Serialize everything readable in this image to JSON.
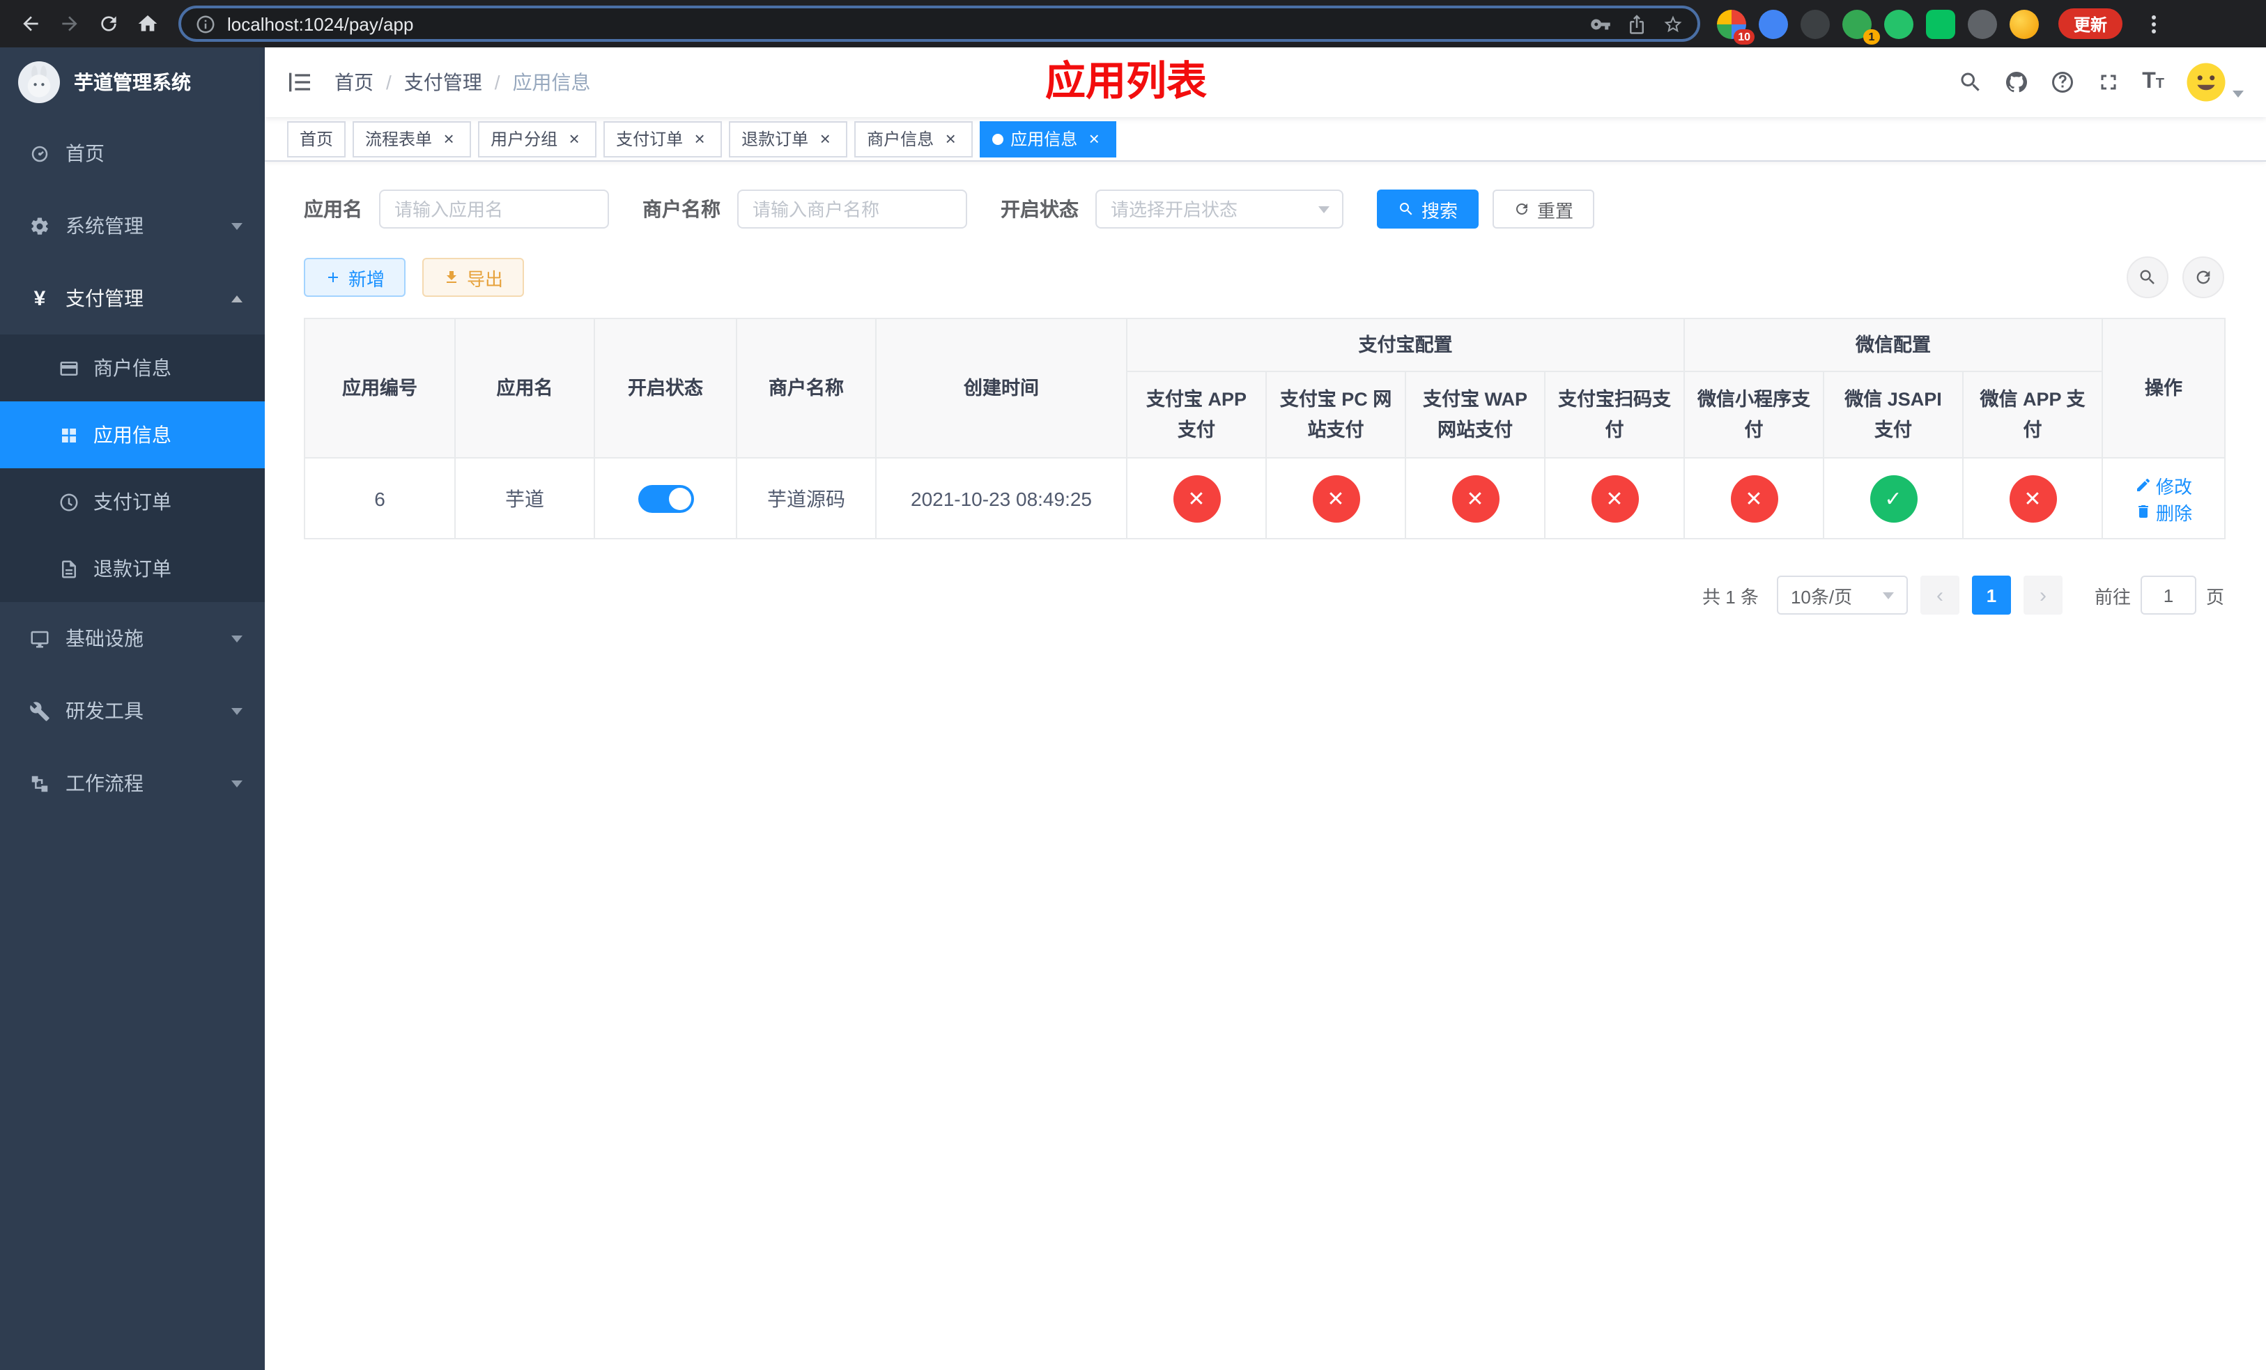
{
  "colors": {
    "primary": "#1890ff",
    "danger": "#f5413d",
    "success": "#19be6b",
    "title": "#f20d0d",
    "sidebar_bg": "#2f3d50"
  },
  "icons": {
    "close_tab": "×",
    "status_on": "✓",
    "status_off": "✕",
    "breadcrumb_separator": "/",
    "prev_arrow": "‹",
    "next_arrow": "›",
    "yen": "¥",
    "font_large": "T",
    "font_small": "T"
  },
  "browser": {
    "url": "localhost:1024/pay/app",
    "update_button": "更新",
    "extension_badge": "10",
    "profile_badge": "1"
  },
  "sidebar": {
    "app_title": "芋道管理系统",
    "menu": [
      {
        "label": "首页"
      },
      {
        "label": "系统管理"
      },
      {
        "label": "支付管理"
      },
      {
        "label": "基础设施"
      },
      {
        "label": "研发工具"
      },
      {
        "label": "工作流程"
      }
    ],
    "pay_submenu": [
      {
        "label": "商户信息"
      },
      {
        "label": "应用信息"
      },
      {
        "label": "支付订单"
      },
      {
        "label": "退款订单"
      }
    ]
  },
  "header": {
    "breadcrumb": [
      "首页",
      "支付管理",
      "应用信息"
    ],
    "page_title": "应用列表"
  },
  "tags": [
    {
      "label": "首页",
      "closable": false,
      "active": false
    },
    {
      "label": "流程表单",
      "closable": true,
      "active": false
    },
    {
      "label": "用户分组",
      "closable": true,
      "active": false
    },
    {
      "label": "支付订单",
      "closable": true,
      "active": false
    },
    {
      "label": "退款订单",
      "closable": true,
      "active": false
    },
    {
      "label": "商户信息",
      "closable": true,
      "active": false
    },
    {
      "label": "应用信息",
      "closable": true,
      "active": true
    }
  ],
  "filters": {
    "app_name_label": "应用名",
    "app_name_placeholder": "请输入应用名",
    "merchant_label": "商户名称",
    "merchant_placeholder": "请输入商户名称",
    "status_label": "开启状态",
    "status_placeholder": "请选择开启状态",
    "search_button": "搜索",
    "reset_button": "重置"
  },
  "toolbar": {
    "add_button": "新增",
    "export_button": "导出"
  },
  "table": {
    "headers": {
      "app_id": "应用编号",
      "app_name": "应用名",
      "status": "开启状态",
      "merchant": "商户名称",
      "created": "创建时间",
      "alipay_group": "支付宝配置",
      "wechat_group": "微信配置",
      "actions": "操作",
      "channels": [
        "支付宝 APP 支付",
        "支付宝 PC 网站支付",
        "支付宝 WAP 网站支付",
        "支付宝扫码支付",
        "微信小程序支付",
        "微信 JSAPI 支付",
        "微信 APP 支付"
      ]
    },
    "rows": [
      {
        "app_id": "6",
        "app_name": "芋道",
        "enabled": true,
        "merchant": "芋道源码",
        "created": "2021-10-23 08:49:25",
        "channels": [
          "off",
          "off",
          "off",
          "off",
          "off",
          "on",
          "off"
        ],
        "edit": "修改",
        "delete": "删除"
      }
    ]
  },
  "pagination": {
    "total": "共 1 条",
    "page_size": "10条/页",
    "current_page": "1",
    "goto_label": "前往",
    "goto_value": "1",
    "page_unit": "页"
  }
}
